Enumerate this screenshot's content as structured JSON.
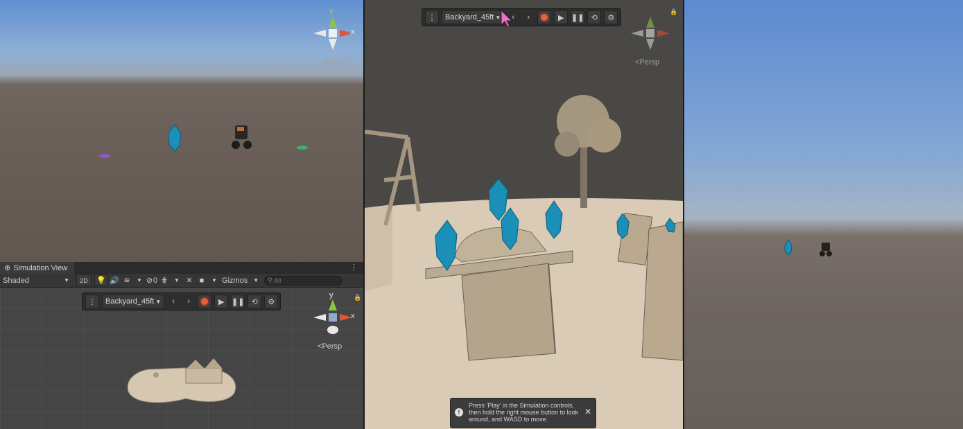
{
  "scene_toolbar": {
    "menu_icon": "kebab-icon",
    "scene_name": "Backyard_45ft",
    "prev_icon": "chevron-left-icon",
    "next_icon": "chevron-right-icon",
    "record_icon": "record-icon",
    "play_icon": "play-icon",
    "pause_icon": "pause-icon",
    "loop_icon": "loop-icon",
    "settings_icon": "gear-icon"
  },
  "gizmo": {
    "y_label": "y",
    "x_label": "x",
    "persp_label": "Persp"
  },
  "simulation_view": {
    "tab_title": "Simulation View",
    "shading_mode": "Shaded",
    "mode_2d": "2D",
    "hidden_count": "0",
    "gizmos_label": "Gizmos",
    "search_placeholder": "All"
  },
  "toast": {
    "message": "Press 'Play' in the Simulation controls, then hold the right mouse button to look around, and WASD to move."
  },
  "colors": {
    "axis_x": "#e0533c",
    "axis_y": "#8bc441",
    "record": "#e0623f",
    "crystal": "#1a8fb8"
  }
}
